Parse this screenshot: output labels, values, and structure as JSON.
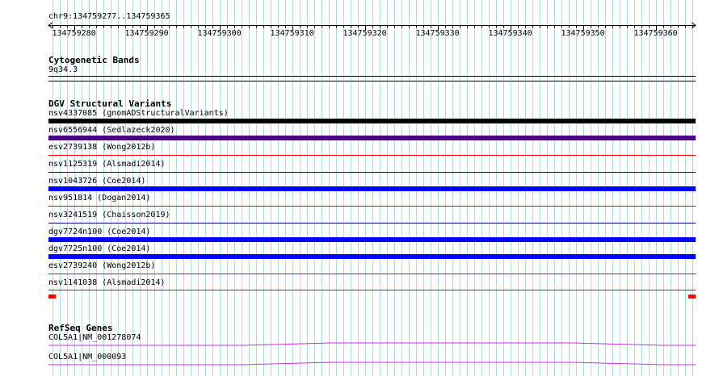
{
  "colors": {
    "grid": "#add8e6",
    "ruler": "#000000",
    "dgv_black": "#000000",
    "dgv_purple": "#4b0082",
    "dgv_blue": "#0000ff",
    "dgv_red": "#ff0000",
    "dgv_thin_blue": "#00008b",
    "gene": "#cc33cc"
  },
  "ruler": {
    "location": "chr9:134759277..134759365",
    "ticks": [
      "134759280",
      "134759290",
      "134759300",
      "134759310",
      "134759320",
      "134759330",
      "134759340",
      "134759350",
      "134759360"
    ]
  },
  "cytoband": {
    "title": "Cytogenetic Bands",
    "band": "9q34.3"
  },
  "dgv": {
    "title": "DGV Structural Variants",
    "items": [
      {
        "label": "nsv4337085 (gnomADStructuralVariants)",
        "style": "thick",
        "color": "#000000"
      },
      {
        "label": "nsv6556944 (Sedlazeck2020)",
        "style": "thick",
        "color": "#4b0082"
      },
      {
        "label": "esv2739138 (Wong2012b)",
        "style": "thin",
        "color": "#ff0000"
      },
      {
        "label": "nsv1125319 (Alsmadi2014)",
        "style": "thin",
        "color": "#00008b"
      },
      {
        "label": "nsv1043726 (Coe2014)",
        "style": "thick",
        "color": "#0000ff"
      },
      {
        "label": "nsv951814 (Dogan2014)",
        "style": "thin",
        "color": "#ff0000"
      },
      {
        "label": "nsv3241519 (Chaisson2019)",
        "style": "thin",
        "color": "#00008b"
      },
      {
        "label": "dgv7724n100 (Coe2014)",
        "style": "thick",
        "color": "#0000ff"
      },
      {
        "label": "dgv7725n100 (Coe2014)",
        "style": "thick",
        "color": "#0000ff"
      },
      {
        "label": "esv2739240 (Wong2012b)",
        "style": "thin",
        "color": "#ff0000"
      },
      {
        "label": "nsv1141038 (Alsmadi2014)",
        "style": "redend",
        "color": "#ff0000"
      }
    ]
  },
  "refseq": {
    "title": "RefSeq Genes",
    "items": [
      {
        "label": "COL5A1|NM_001278074"
      },
      {
        "label": "COL5A1|NM_000093"
      }
    ]
  }
}
